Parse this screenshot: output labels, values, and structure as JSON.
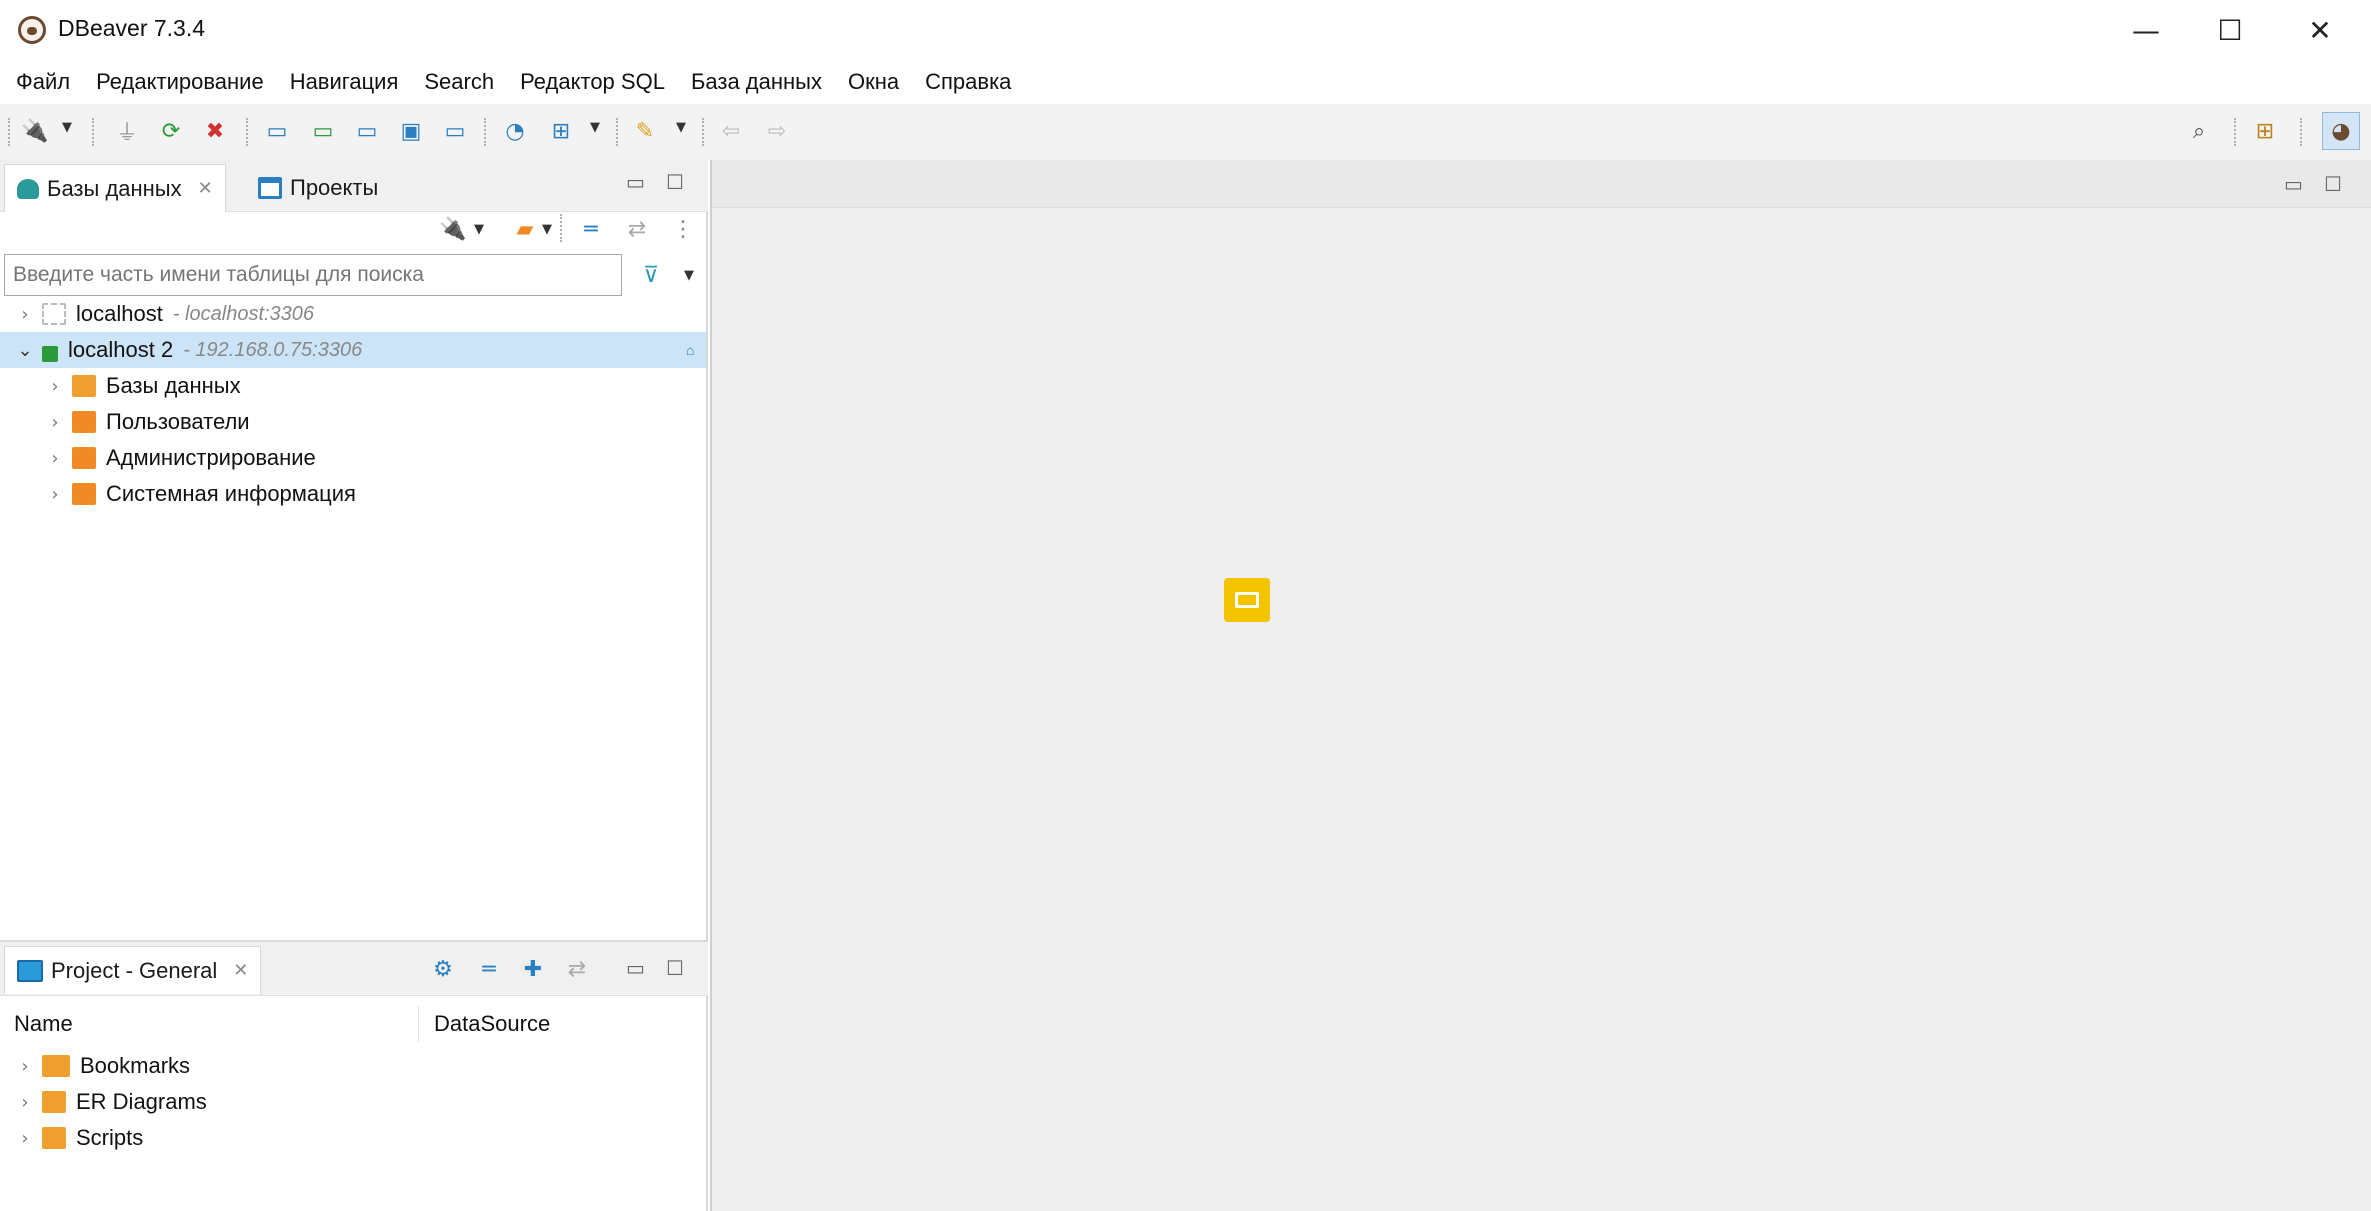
{
  "window": {
    "title": "DBeaver 7.3.4",
    "controls": {
      "minimize": "—",
      "maximize": "☐",
      "close": "✕"
    }
  },
  "menu": [
    "Файл",
    "Редактирование",
    "Навигация",
    "Search",
    "Редактор SQL",
    "База данных",
    "Окна",
    "Справка"
  ],
  "toolbar": {
    "icons": [
      "new-connection-icon",
      "disconnect-icon",
      "reconnect-icon",
      "disconnect-all-icon",
      "sql-editor-icon",
      "open-sql-script-icon",
      "new-sql-script-icon",
      "sql-console-icon",
      "recent-script-icon",
      "dashboard-icon",
      "network-icon",
      "tools-icon",
      "back-icon",
      "forward-icon",
      "search-icon",
      "perspective-icon",
      "dbeaver-perspective-icon"
    ]
  },
  "db_navigator": {
    "tabs": [
      {
        "label": "Базы данных",
        "close": "✕"
      },
      {
        "label": "Проекты"
      }
    ],
    "search_placeholder": "Введите часть имени таблицы для поиска",
    "tree": [
      {
        "label": "localhost",
        "host": "- localhost:3306",
        "expanded": false,
        "connected": false
      },
      {
        "label": "localhost 2",
        "host": "- 192.168.0.75:3306",
        "expanded": true,
        "connected": true,
        "selected": true,
        "children": [
          {
            "label": "Базы данных",
            "icon": "databases-folder-icon",
            "color": "#f0a030"
          },
          {
            "label": "Пользователи",
            "icon": "users-folder-icon",
            "color": "#f08a24"
          },
          {
            "label": "Администрирование",
            "icon": "admin-folder-icon",
            "color": "#f08a24"
          },
          {
            "label": "Системная информация",
            "icon": "system-info-folder-icon",
            "color": "#f08a24"
          }
        ]
      }
    ]
  },
  "project_panel": {
    "tab_label": "Project - General",
    "tab_close": "✕",
    "columns": [
      "Name",
      "DataSource"
    ],
    "items": [
      "Bookmarks",
      "ER Diagrams",
      "Scripts"
    ]
  },
  "colors": {
    "selection": "#cce4f7",
    "accent_orange": "#f08a24",
    "note_yellow": "#f5c400",
    "editor_bg": "#efefef"
  }
}
